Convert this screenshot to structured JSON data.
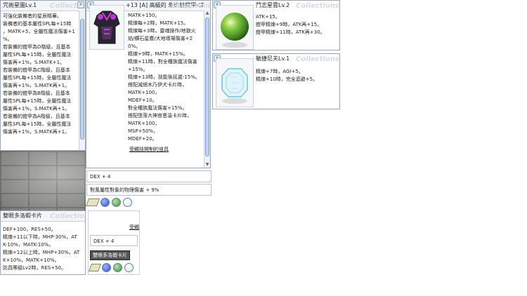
{
  "watermark": "Collections",
  "win_left": {
    "title": "咒術星圖Lv.1",
    "lines": [
      "可強化裝備者的星辰精華。",
      "裝備者的基本屬性SPL每+15時",
      "，MATK+5，全屬性魔法傷害+1",
      "%。",
      "若裝備的鎧甲為D階級，且基本",
      "屬性SPL每+15時，全屬性魔法",
      "傷害再+1%，S.MATK+1。",
      "若裝備的鎧甲為C階級，且基本",
      "屬性SPL每+15時，全屬性魔法",
      "傷害再+1%，S.MATK再+1。",
      "若裝備的鎧甲為B階級，且基本",
      "屬性SPL每+15時，全屬性魔法",
      "傷害再+1%，S.MATK再+1。",
      "若裝備的鎧甲為A階級，且基本",
      "屬性SPL每+15時，全屬性魔法",
      "傷害再+1%，S.MATK再+1。"
    ]
  },
  "win_armor": {
    "title": "+13 [A] 高級的 朱比特鎧甲-LT",
    "lines": [
      "MATK+150。",
      "精煉每+2時，MATK+15。",
      "精煉每+3時，靈魂操作/地獄火",
      "焰/鑽石星塵/大地壞場傷害+2",
      "0%。",
      "精煉+9時，MATK+15%。",
      "精煉+11時，對全種族魔法傷害",
      "+15%。",
      "精煉+13時，技能後延遲-15%。",
      "搭配滅絕木乃伊犬卡片時，",
      "MATK+100，",
      "MDEF+10。",
      "對全種族魔法傷害+15%。",
      "搭配墮落大神官恩溫卡片時，",
      "MATK+100，",
      "MSP+50%，",
      "MDEF+20。",
      "受觸技開制的道具"
    ],
    "bar1": "DEX + 4",
    "bar2": "對風屬性對象的物理傷害 + 9%"
  },
  "win_bottom": {
    "title": "雙眼多洛蝦卡片",
    "lines": [
      "DEF+100，RES+50。",
      "精煉+11以下時，MHP-30%，AT",
      "K-10%，MATK-10%。",
      "精煉+12以上時，MHP+30%，AT",
      "K+10%，MATK+10%。",
      "防具等級Lv2時，RES+50。"
    ],
    "bar1": "DEX + 4",
    "tooltip": "雙眼多洛蝦卡片"
  },
  "mini_label": "受觸",
  "win_fight": {
    "title": "鬥志星雲Lv.2",
    "lines": [
      "ATK+15。",
      "鎧甲精煉+9時，ATK再+15。",
      "鎧甲精煉+11時，ATK再+30。"
    ]
  },
  "win_agi": {
    "title": "敏捷尼夫Lv.1",
    "lines": [
      "精煉+7時，AGI+5。",
      "精煉+10時，完全迴避+5。"
    ]
  },
  "colors": {
    "gem_purple": "#8a4fc4",
    "gem_blue": "#2c4fc7",
    "gem_green": "#3f8c48",
    "gem_white": "#d6ecf4"
  }
}
